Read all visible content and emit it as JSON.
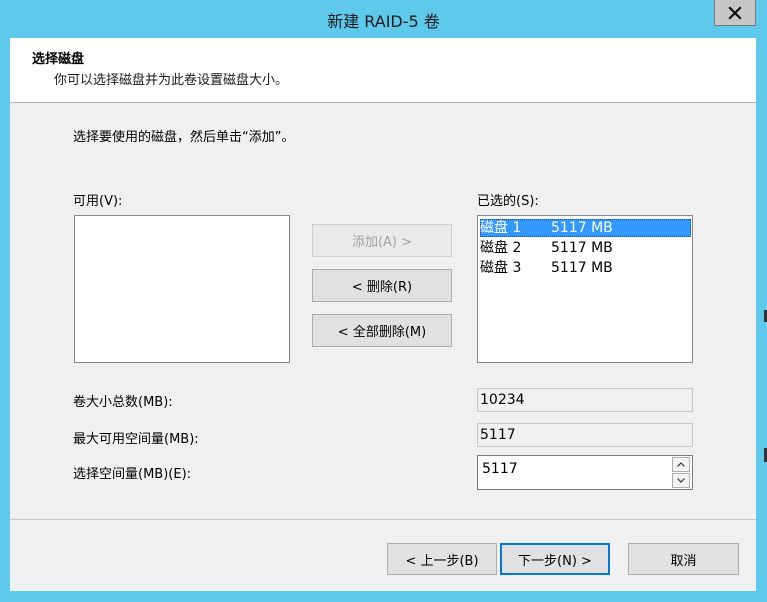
{
  "window": {
    "title": "新建 RAID-5 卷",
    "close_icon": "close-icon"
  },
  "header": {
    "title": "选择磁盘",
    "subtitle": "你可以选择磁盘并为此卷设置磁盘大小。"
  },
  "instruction": "选择要使用的磁盘，然后单击“添加”。",
  "available": {
    "label": "可用(V):",
    "items": []
  },
  "selected": {
    "label": "已选的(S):",
    "items": [
      {
        "name": "磁盘 1",
        "size": "5117 MB",
        "selected": true
      },
      {
        "name": "磁盘 2",
        "size": "5117 MB",
        "selected": false
      },
      {
        "name": "磁盘 3",
        "size": "5117 MB",
        "selected": false
      }
    ]
  },
  "buttons": {
    "add": "添加(A) >",
    "remove": "< 删除(R)",
    "remove_all": "< 全部删除(M)",
    "back": "< 上一步(B)",
    "next": "下一步(N) >",
    "cancel": "取消"
  },
  "fields": {
    "total_label": "卷大小总数(MB):",
    "total_value": "10234",
    "max_label": "最大可用空间量(MB):",
    "max_value": "5117",
    "select_label": "选择空间量(MB)(E):",
    "select_value": "5117"
  },
  "colors": {
    "title_bar": "#5ec9ea",
    "selection": "#3399ff",
    "dialog_bg": "#f0f0f0",
    "default_button_border": "#0078d7"
  }
}
